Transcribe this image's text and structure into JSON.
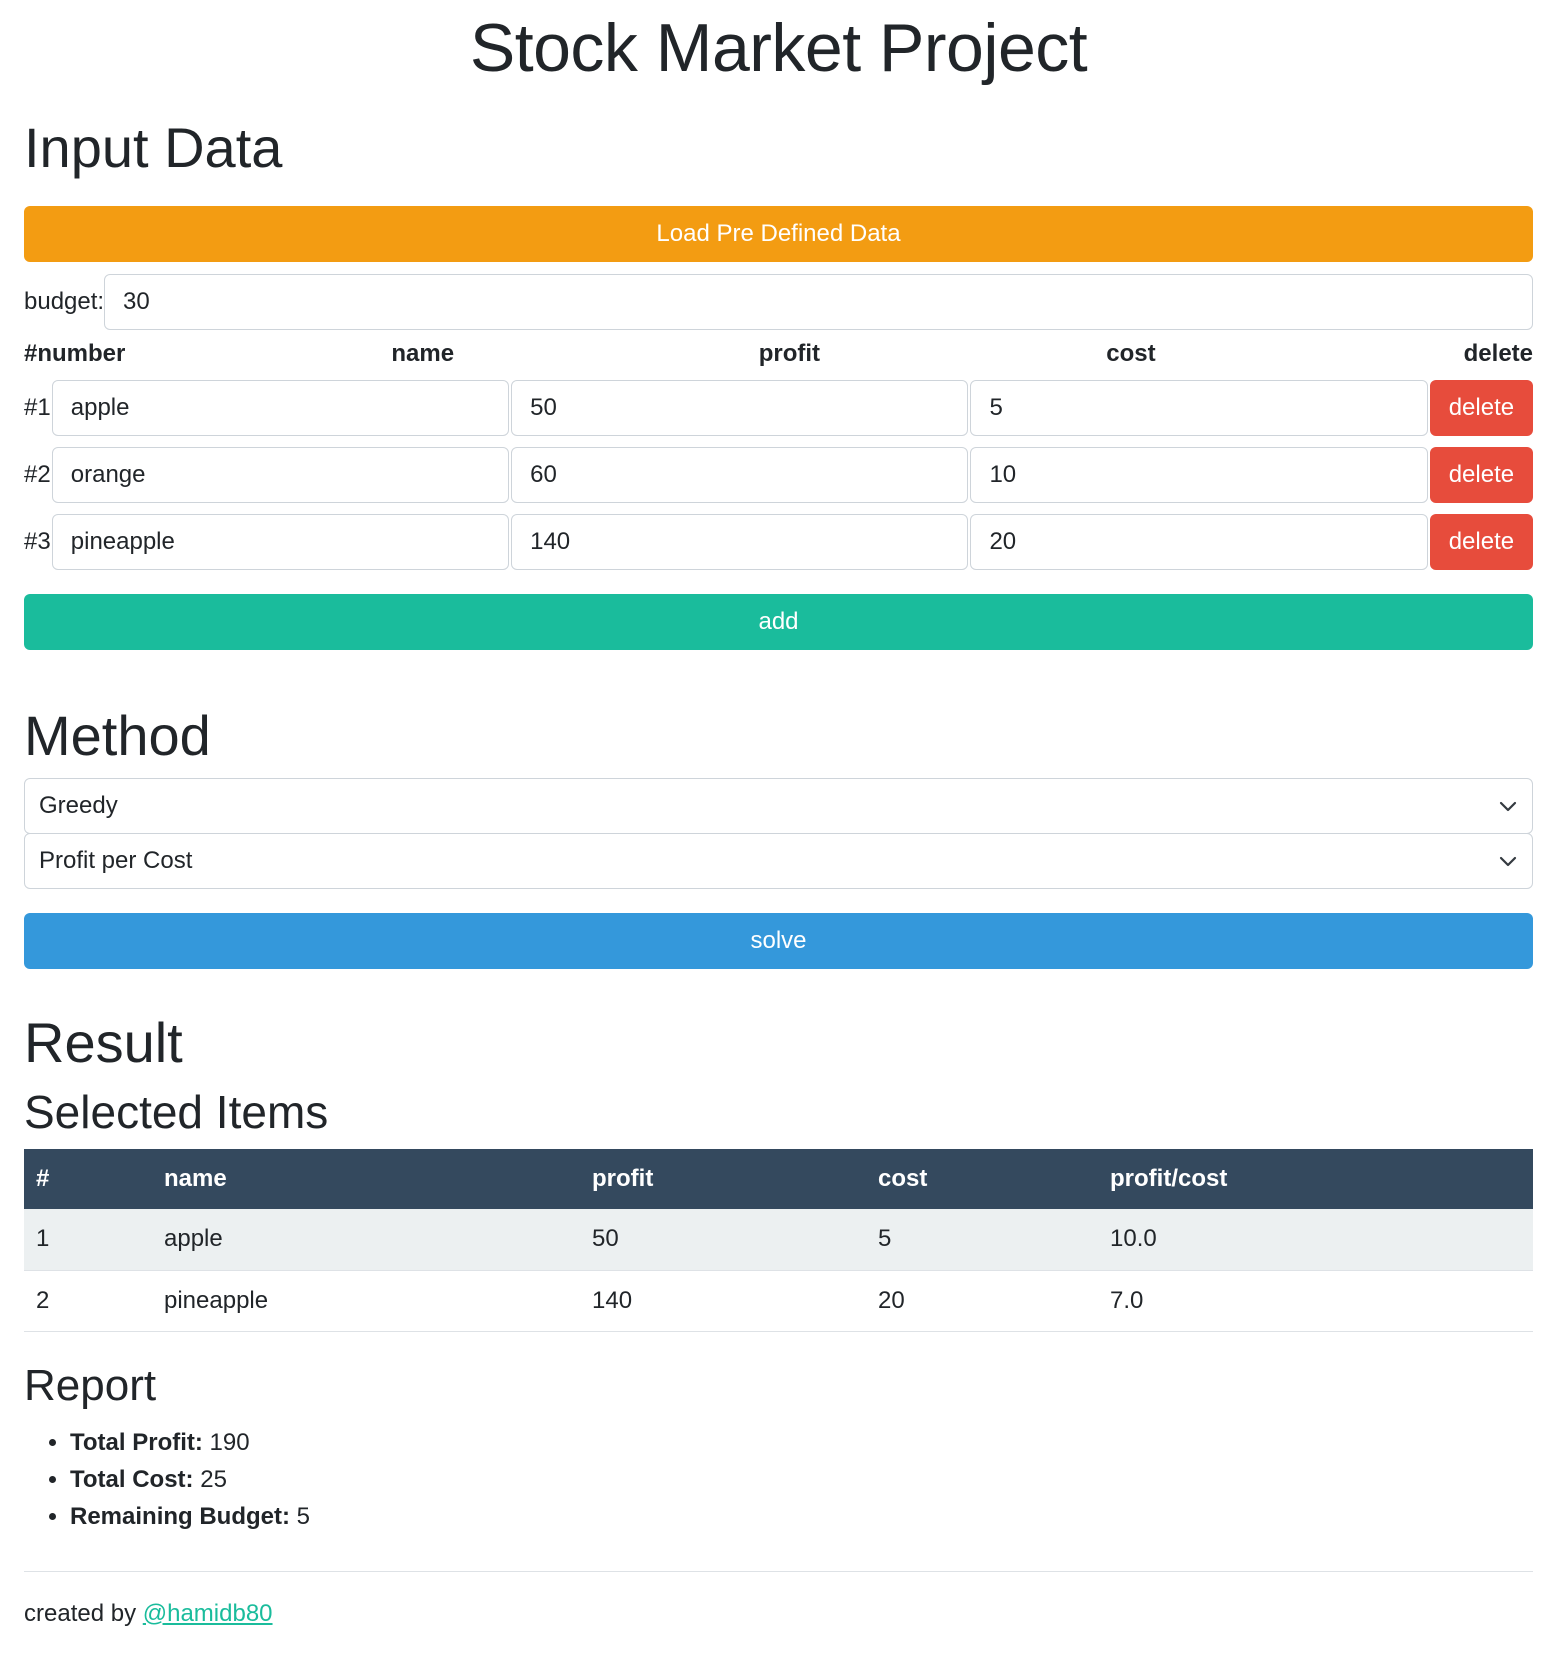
{
  "title": "Stock Market Project",
  "input": {
    "heading": "Input Data",
    "load_button": "Load Pre Defined Data",
    "budget_label": "budget:",
    "budget_value": "30",
    "headers": {
      "number": "#number",
      "name": "name",
      "profit": "profit",
      "cost": "cost",
      "delete": "delete"
    },
    "items": [
      {
        "index": "#1",
        "name": "apple",
        "profit": "50",
        "cost": "5",
        "delete_label": "delete"
      },
      {
        "index": "#2",
        "name": "orange",
        "profit": "60",
        "cost": "10",
        "delete_label": "delete"
      },
      {
        "index": "#3",
        "name": "pineapple",
        "profit": "140",
        "cost": "20",
        "delete_label": "delete"
      }
    ],
    "add_button": "add"
  },
  "method": {
    "heading": "Method",
    "algorithm_selected": "Greedy",
    "criterion_selected": "Profit per Cost",
    "solve_button": "solve"
  },
  "result": {
    "heading": "Result",
    "selected_heading": "Selected Items",
    "columns": [
      "#",
      "name",
      "profit",
      "cost",
      "profit/cost"
    ],
    "rows": [
      [
        "1",
        "apple",
        "50",
        "5",
        "10.0"
      ],
      [
        "2",
        "pineapple",
        "140",
        "20",
        "7.0"
      ]
    ],
    "report_heading": "Report",
    "report": [
      {
        "label": "Total Profit:",
        "value": "190"
      },
      {
        "label": "Total Cost:",
        "value": "25"
      },
      {
        "label": "Remaining Budget:",
        "value": "5"
      }
    ]
  },
  "footer": {
    "text": "created by",
    "link": "@hamidb80"
  },
  "colors": {
    "orange": "#f39c12",
    "green": "#1abc9c",
    "blue": "#3498db",
    "red": "#e74c3c",
    "table_header": "#34495e"
  }
}
